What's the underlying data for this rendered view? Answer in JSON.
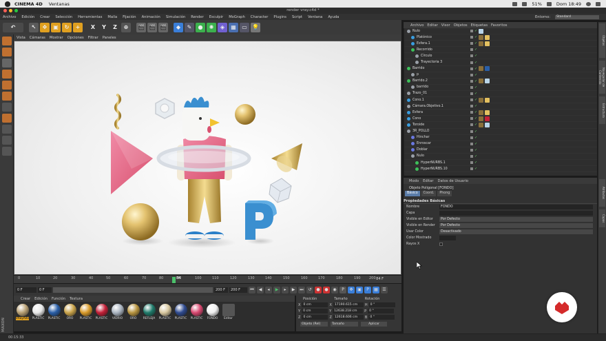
{
  "macbar": {
    "app_name": "CINEMA 4D",
    "menu_ventanas": "Ventanas",
    "battery": "51%",
    "clock": "Dom 18:49"
  },
  "window": {
    "title": "render vray.c4d *"
  },
  "menu": {
    "items": [
      "Archivo",
      "Edición",
      "Crear",
      "Selección",
      "Herramientas",
      "Malla",
      "Fijación",
      "Animación",
      "Simulación",
      "Render",
      "Esculpir",
      "MoGraph",
      "Character",
      "Plugins",
      "Script",
      "Ventana",
      "Ayuda"
    ],
    "entorno_label": "Entorno:",
    "entorno_value": "Standard"
  },
  "toolbar": {
    "axis_x": "X",
    "axis_y": "Y",
    "axis_z": "Z"
  },
  "viewport_menu": {
    "items": [
      "Vista",
      "Cámaras",
      "Mostrar",
      "Opciones",
      "Filtrar",
      "Paneles"
    ]
  },
  "timeline": {
    "ticks": [
      "0",
      "10",
      "20",
      "30",
      "40",
      "50",
      "60",
      "70",
      "80",
      "90",
      "100",
      "110",
      "120",
      "130",
      "140",
      "150",
      "160",
      "170",
      "180",
      "190",
      "200"
    ],
    "current_frame": "84",
    "end_label": "84 F"
  },
  "transport": {
    "start_field": "0 F",
    "min_field": "0 F",
    "max_field": "200 F",
    "end_field": "200 F"
  },
  "material_menu": {
    "items": [
      "Crear",
      "Edición",
      "Función",
      "Textura"
    ]
  },
  "materials": [
    {
      "name": "VRayAdv",
      "color": "#b8a074"
    },
    {
      "name": "PLASTIC",
      "color": "#e8e8e8"
    },
    {
      "name": "PLASTIC",
      "color": "#2a5fa8"
    },
    {
      "name": "ORO",
      "color": "#c9a34a"
    },
    {
      "name": "PLASTIC",
      "color": "#d89a2a"
    },
    {
      "name": "PLASTIC",
      "color": "#c42038"
    },
    {
      "name": "VIDRIO",
      "color": "#aab4c0"
    },
    {
      "name": "ORO",
      "color": "#b89540"
    },
    {
      "name": "REFLEJA",
      "color": "#1f7a6a"
    },
    {
      "name": "PLASTIC",
      "color": "#d8c8a0"
    },
    {
      "name": "PLASTIC",
      "color": "#2f4b90"
    },
    {
      "name": "PLASTIC",
      "color": "#d84870"
    },
    {
      "name": "FONDO",
      "color": "#f0f0f0"
    },
    {
      "name": "Editor",
      "color": "#555555"
    }
  ],
  "coords": {
    "headers": [
      "Posición",
      "Tamaño",
      "Rotación"
    ],
    "rows": [
      {
        "axis": "X",
        "pos": "0 cm",
        "size": "17190.615 cm",
        "rot_axis": "H",
        "rot": "0 °"
      },
      {
        "axis": "Y",
        "pos": "0 cm",
        "size": "12638.218 cm",
        "rot_axis": "P",
        "rot": "0 °"
      },
      {
        "axis": "Z",
        "pos": "0 cm",
        "size": "12618.606 cm",
        "rot_axis": "B",
        "rot": "0 °"
      }
    ],
    "mode_select": "Objeto (Rel)",
    "size_select": "Tamaño",
    "apply_button": "Aplicar"
  },
  "object_menu": {
    "items": [
      "Archivo",
      "Editar",
      "Visor",
      "Objetos",
      "Etiquetas",
      "Favoritos"
    ]
  },
  "objects": [
    {
      "name": "Nulo",
      "indent": 0,
      "color": "#9aa0a8",
      "tags": [
        "#b9d4e8"
      ]
    },
    {
      "name": "Platónico",
      "indent": 1,
      "color": "#3a9ee0",
      "tags": [
        "#8a6f3a",
        "#e3c060"
      ]
    },
    {
      "name": "Esfera.1",
      "indent": 1,
      "color": "#3a9ee0",
      "tags": [
        "#8a6f3a",
        "#e3c060"
      ]
    },
    {
      "name": "Recorrido",
      "indent": 1,
      "color": "#3ec05a",
      "tags": []
    },
    {
      "name": "Círculo",
      "indent": 2,
      "color": "#9aa0a8",
      "tags": []
    },
    {
      "name": "Trayectoria 3",
      "indent": 2,
      "color": "#9aa0a8",
      "tags": []
    },
    {
      "name": "Barrido",
      "indent": 0,
      "color": "#3ec05a",
      "tags": [
        "#8a6f3a",
        "#2a5fa8"
      ]
    },
    {
      "name": "p",
      "indent": 1,
      "color": "#9aa0a8",
      "tags": []
    },
    {
      "name": "Barrido.2",
      "indent": 0,
      "color": "#3ec05a",
      "tags": [
        "#8a6f3a",
        "#b9d4e8"
      ]
    },
    {
      "name": "barrido",
      "indent": 1,
      "color": "#9aa0a8",
      "tags": []
    },
    {
      "name": "Trazo_01",
      "indent": 0,
      "color": "#9aa0a8",
      "tags": []
    },
    {
      "name": "Cono.1",
      "indent": 0,
      "color": "#3a9ee0",
      "tags": [
        "#8a6f3a",
        "#e3c060"
      ]
    },
    {
      "name": "Cámara.Objetivo.1",
      "indent": 0,
      "color": "#9aa0a8",
      "tags": []
    },
    {
      "name": "Esfera",
      "indent": 0,
      "color": "#3a9ee0",
      "tags": [
        "#8a6f3a",
        "#e3c060"
      ]
    },
    {
      "name": "Cono",
      "indent": 0,
      "color": "#3a9ee0",
      "tags": [
        "#8a6f3a",
        "#c42038"
      ]
    },
    {
      "name": "Toroide",
      "indent": 0,
      "color": "#3a9ee0",
      "tags": [
        "#8a6f3a",
        "#b9d4e8"
      ]
    },
    {
      "name": "3R_POLLO",
      "indent": 0,
      "color": "#9aa0a8",
      "tags": []
    },
    {
      "name": "Hinchar",
      "indent": 1,
      "color": "#6a78e0",
      "tags": []
    },
    {
      "name": "Enroscar",
      "indent": 1,
      "color": "#6a78e0",
      "tags": []
    },
    {
      "name": "Doblar",
      "indent": 1,
      "color": "#6a78e0",
      "tags": []
    },
    {
      "name": "Nulo",
      "indent": 1,
      "color": "#9aa0a8",
      "tags": []
    },
    {
      "name": "HyperNURBS.1",
      "indent": 2,
      "color": "#3ec05a",
      "tags": []
    },
    {
      "name": "HyperNURBS.10",
      "indent": 2,
      "color": "#3ec05a",
      "tags": []
    }
  ],
  "attr_menu": {
    "items": [
      "Modo",
      "Editar",
      "Datos de Usuario"
    ]
  },
  "attributes": {
    "object_title": "Objeto Poligonal [FONDO]",
    "tabs": [
      "Básico",
      "Coord.",
      "Phong"
    ],
    "section": "Propiedades Básicas",
    "fields": [
      {
        "label": "Nombre",
        "value": "FONDO",
        "select": false
      },
      {
        "label": "Capa",
        "value": "",
        "select": false
      },
      {
        "label": "Visible en Editor",
        "value": "Por Defecto",
        "select": true
      },
      {
        "label": "Visible en Render",
        "value": "Por Defecto",
        "select": true
      },
      {
        "label": "Usar Color",
        "value": "Desactivado",
        "select": true
      },
      {
        "label": "Color Mostrado",
        "value": "",
        "select": false
      },
      {
        "label": "Rayos X",
        "value": "",
        "select": false
      }
    ]
  },
  "status": {
    "time": "00:15:33"
  },
  "right_strip": {
    "tabs": [
      "Objetos",
      "Navegador de Contenido",
      "Estructura",
      "Atributos",
      "Capas"
    ]
  },
  "maxon_label": "MAXON"
}
